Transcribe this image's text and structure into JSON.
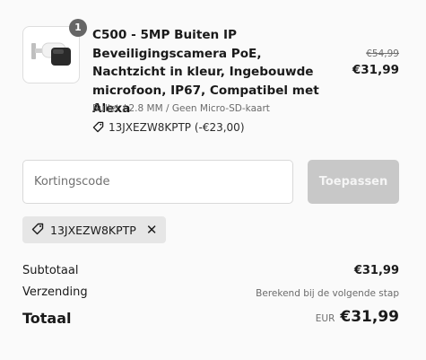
{
  "line_item": {
    "quantity": "1",
    "title": "C500 - 5MP Buiten IP Beveiligingscamera PoE, Nachtzicht in kleur, Ingebouwde microfoon, IP67, Compatibel met Alexa",
    "variant": "Bullet / 2.8 MM / Geen Micro-SD-kaart",
    "discount": "13JXEZW8KPTP (-€23,00)",
    "price_original": "€54,99",
    "price_final": "€31,99",
    "image_icon": "bullet-camera-icon"
  },
  "coupon": {
    "placeholder": "Kortingscode",
    "value": "",
    "apply_label": "Toepassen"
  },
  "applied_code": {
    "code": "13JXEZW8KPTP",
    "remove_symbol": "✕"
  },
  "totals": {
    "subtotal_label": "Subtotaal",
    "subtotal_value": "€31,99",
    "shipping_label": "Verzending",
    "shipping_value": "Berekend bij de volgende stap",
    "total_label": "Totaal",
    "currency": "EUR",
    "total_value": "€31,99"
  },
  "colors": {
    "background": "#fafafa",
    "button_disabled": "#c8c8c8",
    "tag_background": "#e6e6e6",
    "badge": "#666666"
  }
}
